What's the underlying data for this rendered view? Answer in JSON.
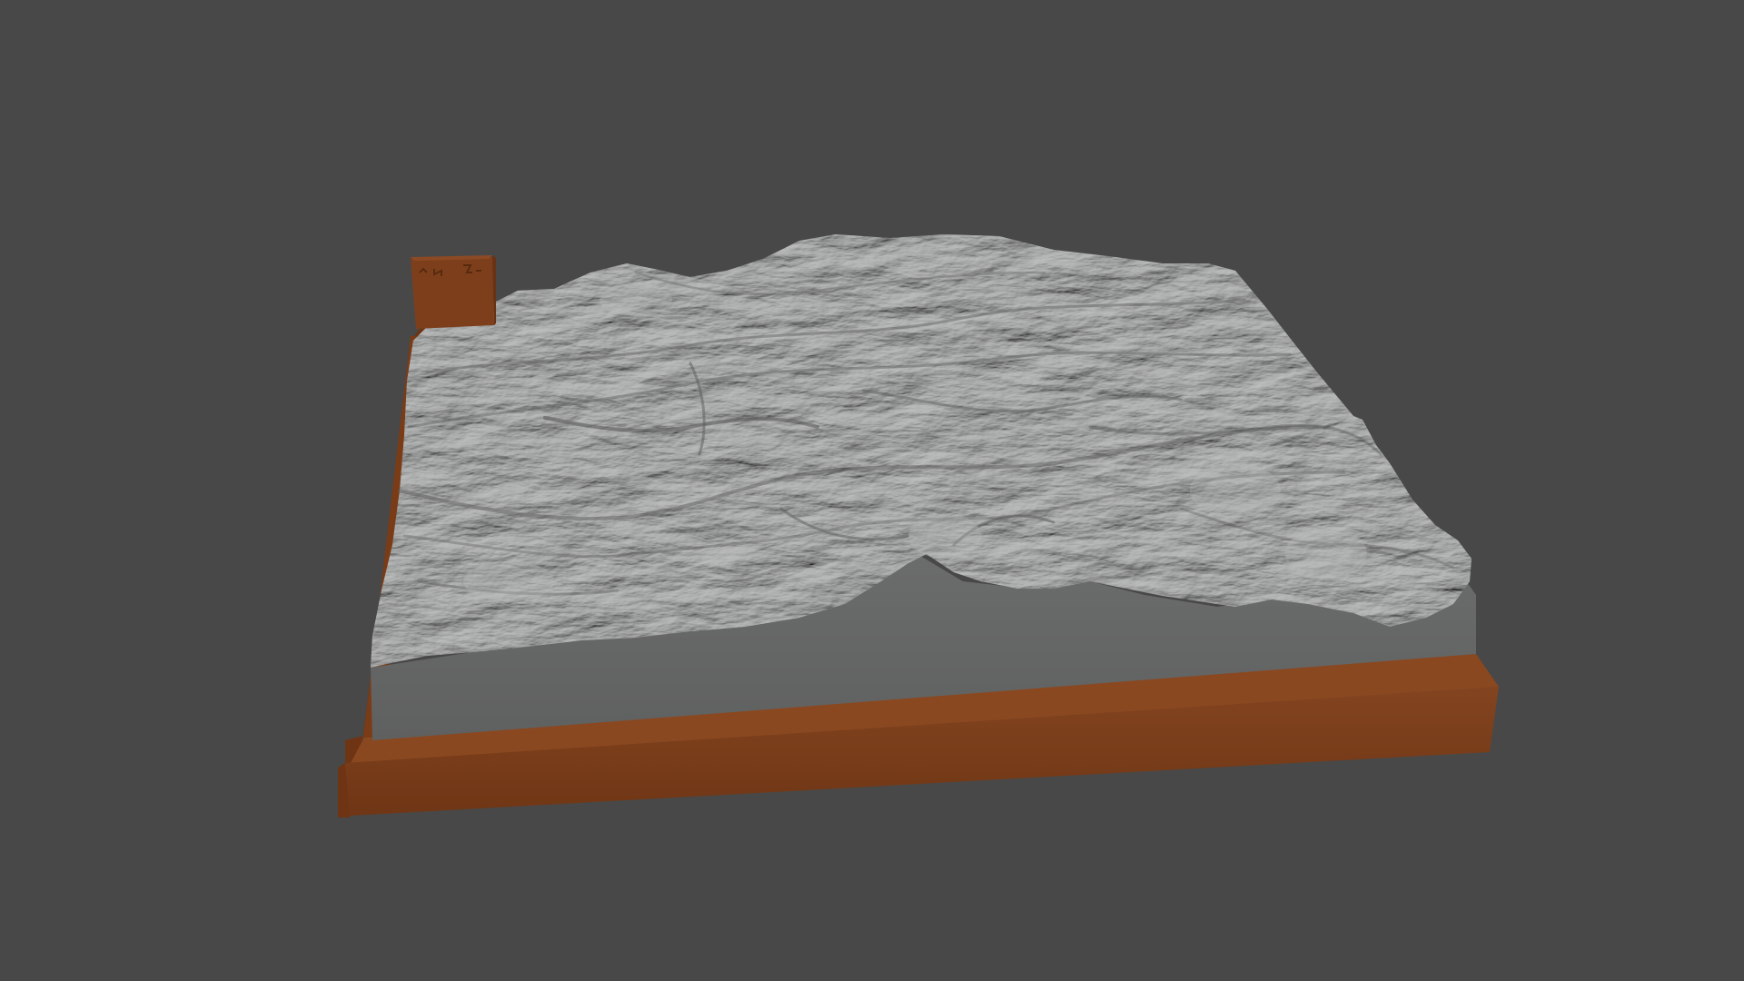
{
  "viewport": {
    "background_color": "#484848"
  },
  "model": {
    "subject": "terrain-relief-model",
    "terrain_color": "#8f9090",
    "terrain_side_color": "#646565",
    "base_color": "#7a3d18",
    "base_shadow_color": "#5c2c10",
    "label_block_color": "#7d3f1b",
    "label_block_marking": "engraved-logo"
  }
}
